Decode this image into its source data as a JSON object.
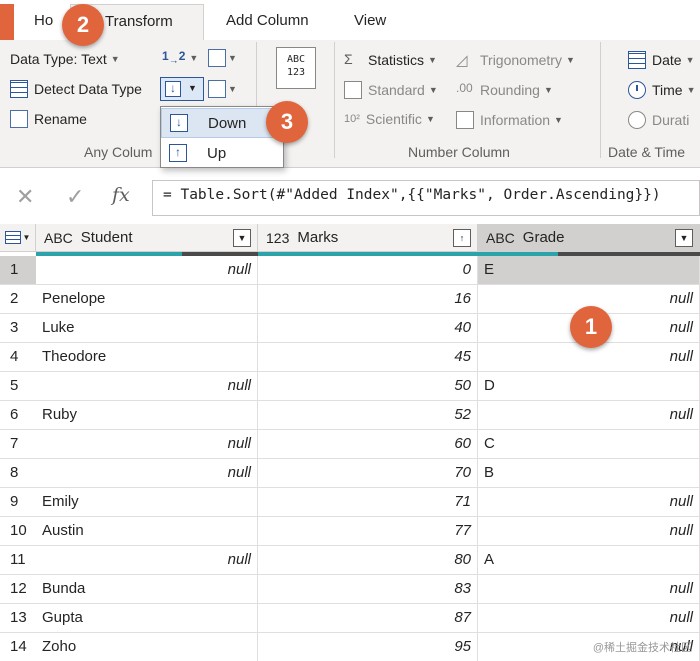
{
  "tabs": [
    "Ho",
    "Transform",
    "Add Column",
    "View"
  ],
  "ribbon": {
    "any_column": {
      "data_type": "Data Type: Text",
      "detect": "Detect Data Type",
      "rename": "Rename",
      "label": "Any Colum"
    },
    "fill_menu": {
      "down": "Down",
      "up": "Up"
    },
    "big_icon_text": [
      "ABC",
      "123"
    ],
    "number_column": {
      "statistics": "Statistics",
      "standard": "Standard",
      "scientific": "Scientific",
      "trigonometry": "Trigonometry",
      "rounding": "Rounding",
      "information": "Information",
      "label": "Number Column",
      "sci_prefix": "10²"
    },
    "date_time": {
      "date": "Date",
      "time": "Time",
      "duration": "Durati",
      "label": "Date & Time"
    }
  },
  "formula_bar": {
    "fx": "fx",
    "formula_prefix": "= Table.Sort(#\"Added Index\",{{\"Marks\", Order.Ascending}})"
  },
  "columns": [
    {
      "type": "ABC",
      "name": "Student"
    },
    {
      "type": "123",
      "name": "Marks"
    },
    {
      "type": "ABC",
      "name": "Grade"
    }
  ],
  "rows": [
    {
      "n": "1",
      "student": "null",
      "marks": "0",
      "grade": "E"
    },
    {
      "n": "2",
      "student": "Penelope",
      "marks": "16",
      "grade": "null"
    },
    {
      "n": "3",
      "student": "Luke",
      "marks": "40",
      "grade": "null"
    },
    {
      "n": "4",
      "student": "Theodore",
      "marks": "45",
      "grade": "null"
    },
    {
      "n": "5",
      "student": "null",
      "marks": "50",
      "grade": "D"
    },
    {
      "n": "6",
      "student": "Ruby",
      "marks": "52",
      "grade": "null"
    },
    {
      "n": "7",
      "student": "null",
      "marks": "60",
      "grade": "C"
    },
    {
      "n": "8",
      "student": "null",
      "marks": "70",
      "grade": "B"
    },
    {
      "n": "9",
      "student": "Emily",
      "marks": "71",
      "grade": "null"
    },
    {
      "n": "10",
      "student": "Austin",
      "marks": "77",
      "grade": "null"
    },
    {
      "n": "11",
      "student": "null",
      "marks": "80",
      "grade": "A"
    },
    {
      "n": "12",
      "student": "Bunda",
      "marks": "83",
      "grade": "null"
    },
    {
      "n": "13",
      "student": "Gupta",
      "marks": "87",
      "grade": "null"
    },
    {
      "n": "14",
      "student": "Zoho",
      "marks": "95",
      "grade": "null"
    }
  ],
  "callouts": [
    "1",
    "2",
    "3"
  ],
  "watermark": "@稀土掘金技术社区",
  "colors": {
    "callout": "#e0643c",
    "accent": "#2b579a",
    "quality_ok": "#2ba3a8",
    "quality_empty": "#4a4a4a"
  }
}
